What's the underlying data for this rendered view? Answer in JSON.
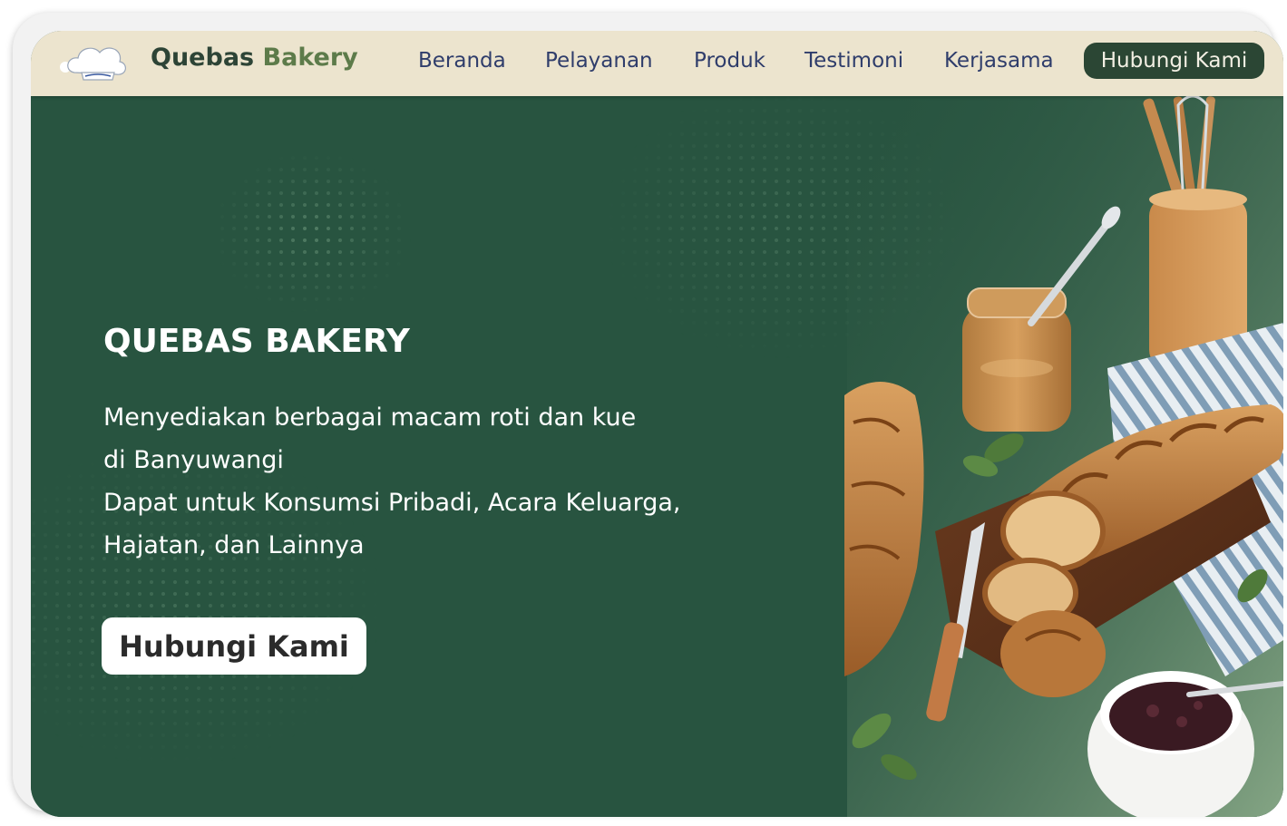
{
  "brand": {
    "name_part1": "Quebas",
    "name_part2": "Bakery"
  },
  "nav": {
    "items": [
      {
        "label": "Beranda"
      },
      {
        "label": "Pelayanan"
      },
      {
        "label": "Produk"
      },
      {
        "label": "Testimoni"
      },
      {
        "label": "Kerjasama"
      }
    ],
    "cta_label": "Hubungi Kami"
  },
  "hero": {
    "title": "QUEBAS BAKERY",
    "description_lines": [
      "Menyediakan berbagai macam roti dan kue",
      "di Banyuwangi",
      "Dapat untuk Konsumsi Pribadi, Acara Keluarga,",
      "Hajatan, dan Lainnya"
    ],
    "button_label": "Hubungi Kami"
  },
  "icons": {
    "logo": "chef-hat-logo-icon",
    "hero_image": "bread-and-jam-photo"
  },
  "colors": {
    "hero_bg": "#285440",
    "nav_bg": "#ece4ce",
    "nav_text": "#2f3d6b",
    "brand_dark": "#2d4436",
    "brand_accent": "#5d7b4a",
    "cta_bg": "#2b4634"
  }
}
